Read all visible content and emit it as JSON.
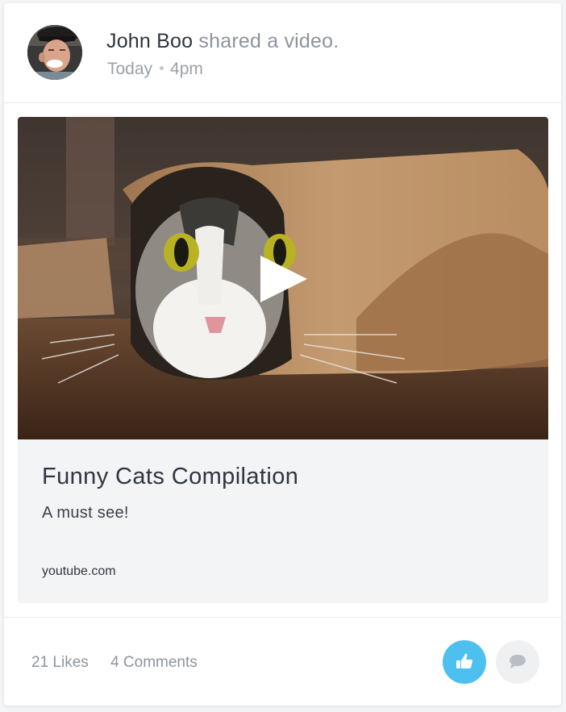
{
  "post": {
    "author": "John Boo",
    "action": "shared a video.",
    "date": "Today",
    "time": "4pm",
    "avatar_icon": "user-avatar-photo"
  },
  "video": {
    "thumbnail_icon": "cat-in-paper-roll-thumbnail",
    "play_icon": "play-icon",
    "title": "Funny Cats Compilation",
    "description": "A must see!",
    "domain": "youtube.com"
  },
  "footer": {
    "likes": "21 Likes",
    "comments": "4 Comments",
    "like_icon": "thumbs-up-icon",
    "comment_icon": "speech-bubble-icon"
  },
  "colors": {
    "accent": "#4dc0f0",
    "text_primary": "#2f3640",
    "text_muted": "#8d949e",
    "panel_bg": "#f3f4f6"
  }
}
